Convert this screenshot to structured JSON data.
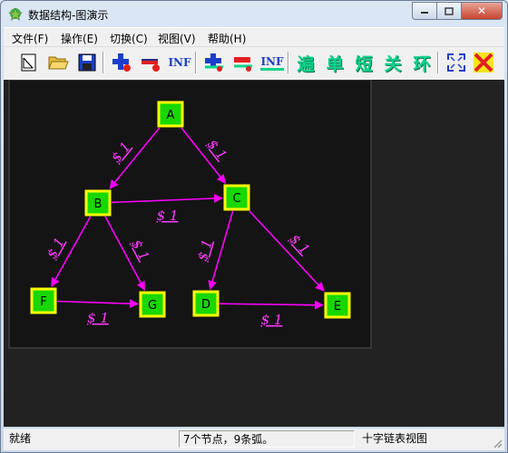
{
  "window": {
    "title": "数据结构-图演示",
    "close_symbol": "✕"
  },
  "menu": [
    "文件(F)",
    "操作(E)",
    "切换(C)",
    "视图(V)",
    "帮助(H)"
  ],
  "toolbar": {
    "inf_label": "INF",
    "glyphs": [
      "遍",
      "单",
      "短",
      "关",
      "环"
    ],
    "accent_colors": {
      "green": "#0bd38a",
      "red": "#e02020",
      "blue": "#1b3fc8"
    }
  },
  "graph": {
    "nodes": [
      {
        "id": "A",
        "label": "A"
      },
      {
        "id": "B",
        "label": "B"
      },
      {
        "id": "C",
        "label": "C"
      },
      {
        "id": "D",
        "label": "D"
      },
      {
        "id": "E",
        "label": "E"
      },
      {
        "id": "F",
        "label": "F"
      },
      {
        "id": "G",
        "label": "G"
      }
    ],
    "edges": [
      {
        "from": "A",
        "to": "B",
        "weight": "$ 1"
      },
      {
        "from": "A",
        "to": "C",
        "weight": "$ 1"
      },
      {
        "from": "B",
        "to": "C",
        "weight": "$ 1"
      },
      {
        "from": "B",
        "to": "F",
        "weight": "$ 1"
      },
      {
        "from": "B",
        "to": "G",
        "weight": "$ 1"
      },
      {
        "from": "F",
        "to": "G",
        "weight": "$ 1"
      },
      {
        "from": "C",
        "to": "D",
        "weight": "$ 1"
      },
      {
        "from": "C",
        "to": "E",
        "weight": "$ 1"
      },
      {
        "from": "D",
        "to": "E",
        "weight": "$ 1"
      }
    ]
  },
  "status": {
    "ready": "就绪",
    "info": "7个节点，9条弧。",
    "view_mode": "十字链表视图"
  }
}
